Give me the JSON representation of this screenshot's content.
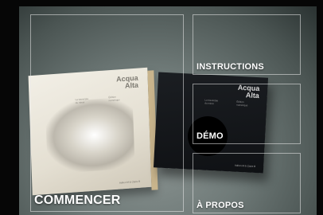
{
  "menu": {
    "start_label": "COMMENCER",
    "instructions_label": "INSTRUCTIONS",
    "demo_label": "DÉMO",
    "about_label": "À PROPOS"
  },
  "books": {
    "white": {
      "title": "Acqua\nAlta",
      "small": "La traversée\ndu miroir",
      "small2": "Édition\nnumérique",
      "publisher": "Adrien M & Claire B"
    },
    "black": {
      "title": "Acqua\nAlta",
      "small": "La traversée\ndu miroir",
      "small2": "Édition\nnumérique",
      "publisher": "Adrien M & Claire B"
    }
  }
}
